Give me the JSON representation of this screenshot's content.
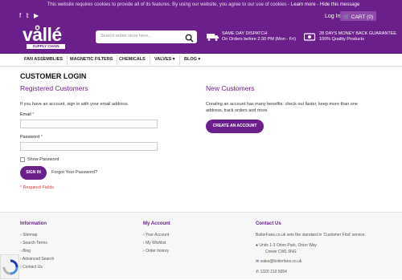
{
  "colors": {
    "brand": "#6b1f8a",
    "accent": "#d33333"
  },
  "top_bar": {
    "social_icons": [
      "facebook-icon",
      "twitter-icon",
      "youtube-icon"
    ],
    "cookie_text": "This website requires cookies to provide all of its features. By using our website, you agree to our use of cookies -",
    "learn_more": "Learn more",
    "hide_message": "Hide this message",
    "login": "Log In",
    "cart": "CART (0)"
  },
  "header": {
    "logo_text": "vållé",
    "logo_tag": "SUPPLY CHAIN",
    "search_placeholder": "Search entire store here...",
    "usp1_title": "SAME DAY DISPATCH",
    "usp1_sub": "On Orders before 2:30 PM (Mon - Fri)",
    "usp2_title": "28 DAYS MONEY BACK GUARANTEE",
    "usp2_sub": "100% Quality Products"
  },
  "nav": [
    "FAN ASSEMBLIES",
    "MAGNETIC FILTERS",
    "CHEMICALS",
    "VALVES",
    "BLOG"
  ],
  "main": {
    "title": "CUSTOMER LOGIN",
    "registered": {
      "heading": "Registered Customers",
      "intro": "If you have an account, sign in with your email address.",
      "email_label": "Email",
      "password_label": "Password",
      "show_password": "Show Password",
      "sign_in": "SIGN IN",
      "forgot": "Forgot Your Password?",
      "required": "* Required Fields"
    },
    "new": {
      "heading": "New Customers",
      "text1": "Creating an account has many benefits: check out faster, keep more than one",
      "text2": "address, track orders and more.",
      "button": "CREATE AN ACCOUNT"
    }
  },
  "footer": {
    "information": {
      "heading": "Information",
      "items": [
        "Sitemap",
        "Search Terms",
        "Blog",
        "Advanced Search",
        "Contact Us"
      ]
    },
    "account": {
      "heading": "My Account",
      "items": [
        "Your Account",
        "My Wishlist",
        "Order history"
      ]
    },
    "contact": {
      "heading": "Contact Us",
      "intro": "BoilerFans.co.uk sets the standard in 'Customer First' service.",
      "address1": "Units 1-3 Orion Park, Orion Way",
      "address2": "Crewe CW1 6NG",
      "email": "sales@boilerfans.co.uk",
      "phone": "1320 210 5054"
    }
  }
}
